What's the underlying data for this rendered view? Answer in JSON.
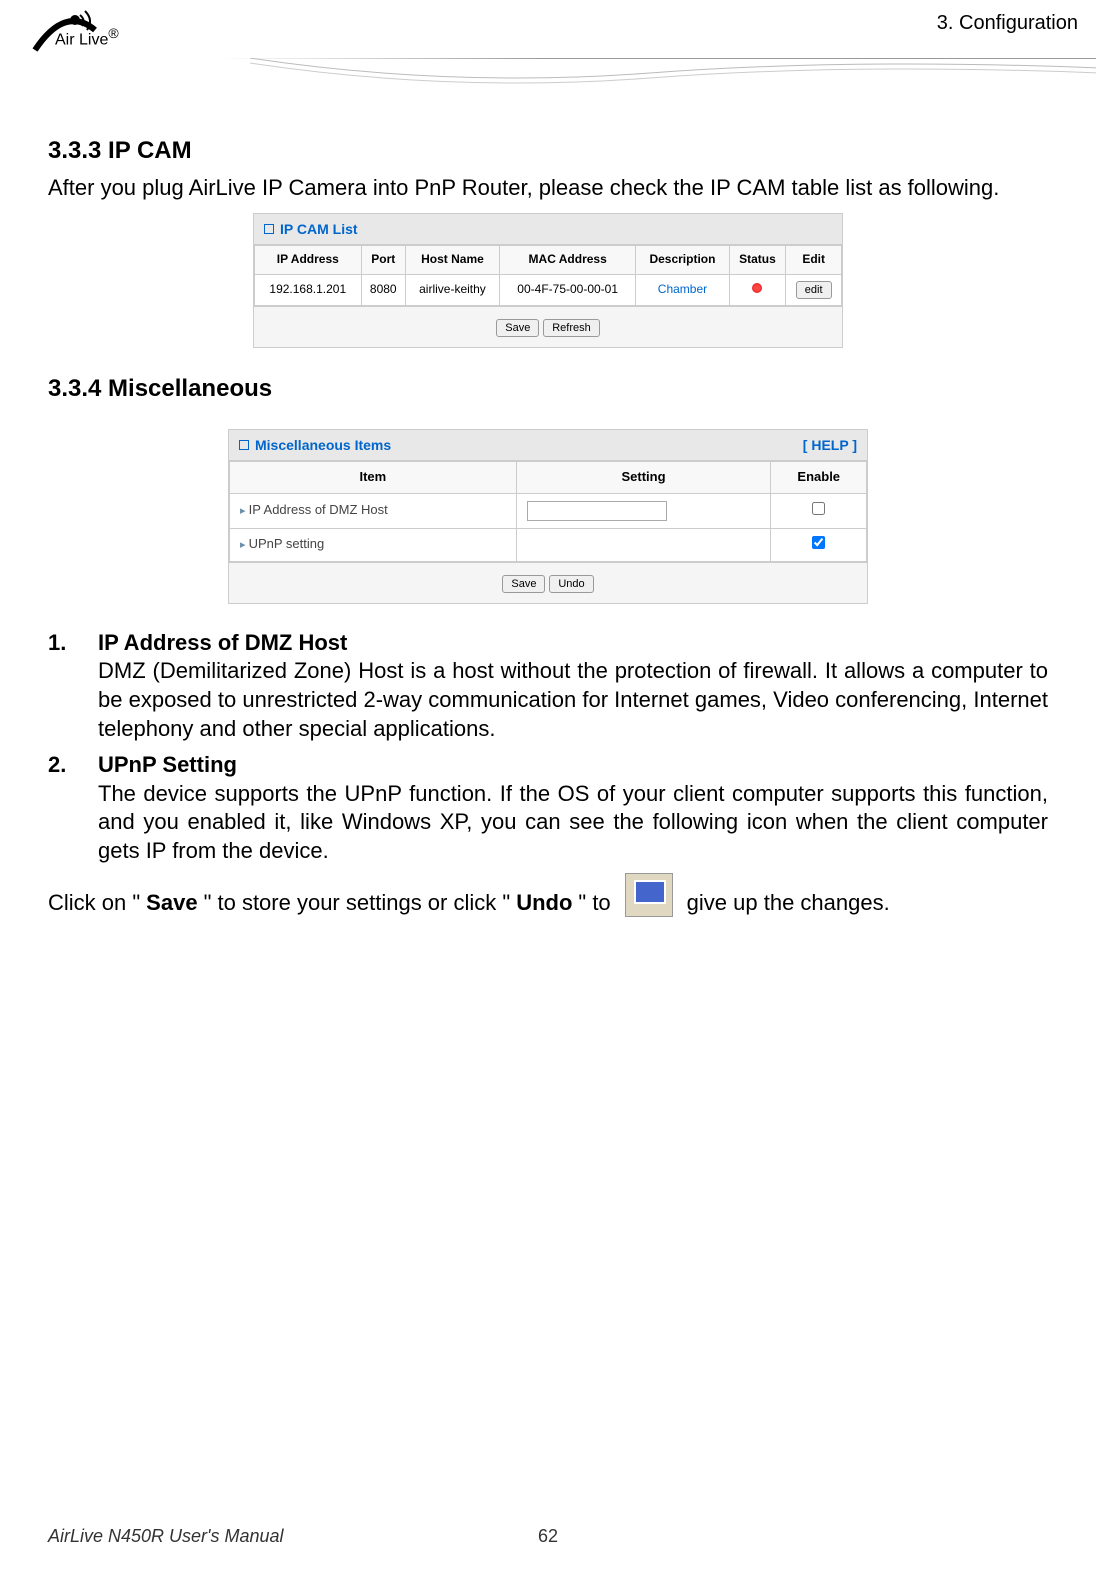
{
  "header": {
    "logo_text": "Air Live",
    "logo_r": "®",
    "chapter": "3.  Configuration"
  },
  "sections": {
    "ipcam": {
      "title": "3.3.3 IP CAM",
      "intro": "After you plug AirLive IP Camera into PnP Router, please check the IP CAM table list as following.",
      "panel_title": "IP CAM List",
      "columns": [
        "IP Address",
        "Port",
        "Host Name",
        "MAC Address",
        "Description",
        "Status",
        "Edit"
      ],
      "row": {
        "ip": "192.168.1.201",
        "port": "8080",
        "host": "airlive-keithy",
        "mac": "00-4F-75-00-00-01",
        "desc": "Chamber",
        "edit": "edit"
      },
      "buttons": {
        "save": "Save",
        "refresh": "Refresh"
      }
    },
    "misc": {
      "title": "3.3.4 Miscellaneous",
      "panel_title": "Miscellaneous Items",
      "help": "[ HELP ]",
      "columns": [
        "Item",
        "Setting",
        "Enable"
      ],
      "rows": [
        {
          "item": "IP Address of DMZ Host",
          "checked": false
        },
        {
          "item": "UPnP setting",
          "checked": true
        }
      ],
      "buttons": {
        "save": "Save",
        "undo": "Undo"
      }
    }
  },
  "list": {
    "item1": {
      "num": "1.",
      "heading": "IP Address of DMZ Host",
      "body": "DMZ (Demilitarized Zone) Host is a host without the protection of firewall. It allows a computer to be exposed to unrestricted 2-way communication for Internet games, Video conferencing, Internet telephony and other special applications."
    },
    "item2": {
      "num": "2.",
      "heading": "UPnP Setting",
      "body_a": "The device supports the UPnP function. If the OS of your client computer supports this function, and you enabled it, like Windows XP, you can see the following icon when the client computer gets IP from the device."
    },
    "final": {
      "a": "Click on \"",
      "save": "Save",
      "b": "\" to store your settings or click \"",
      "undo": "Undo",
      "c": "\" to",
      "d": "give up the changes."
    }
  },
  "footer": {
    "title": "AirLive N450R User's Manual",
    "page": "62"
  }
}
